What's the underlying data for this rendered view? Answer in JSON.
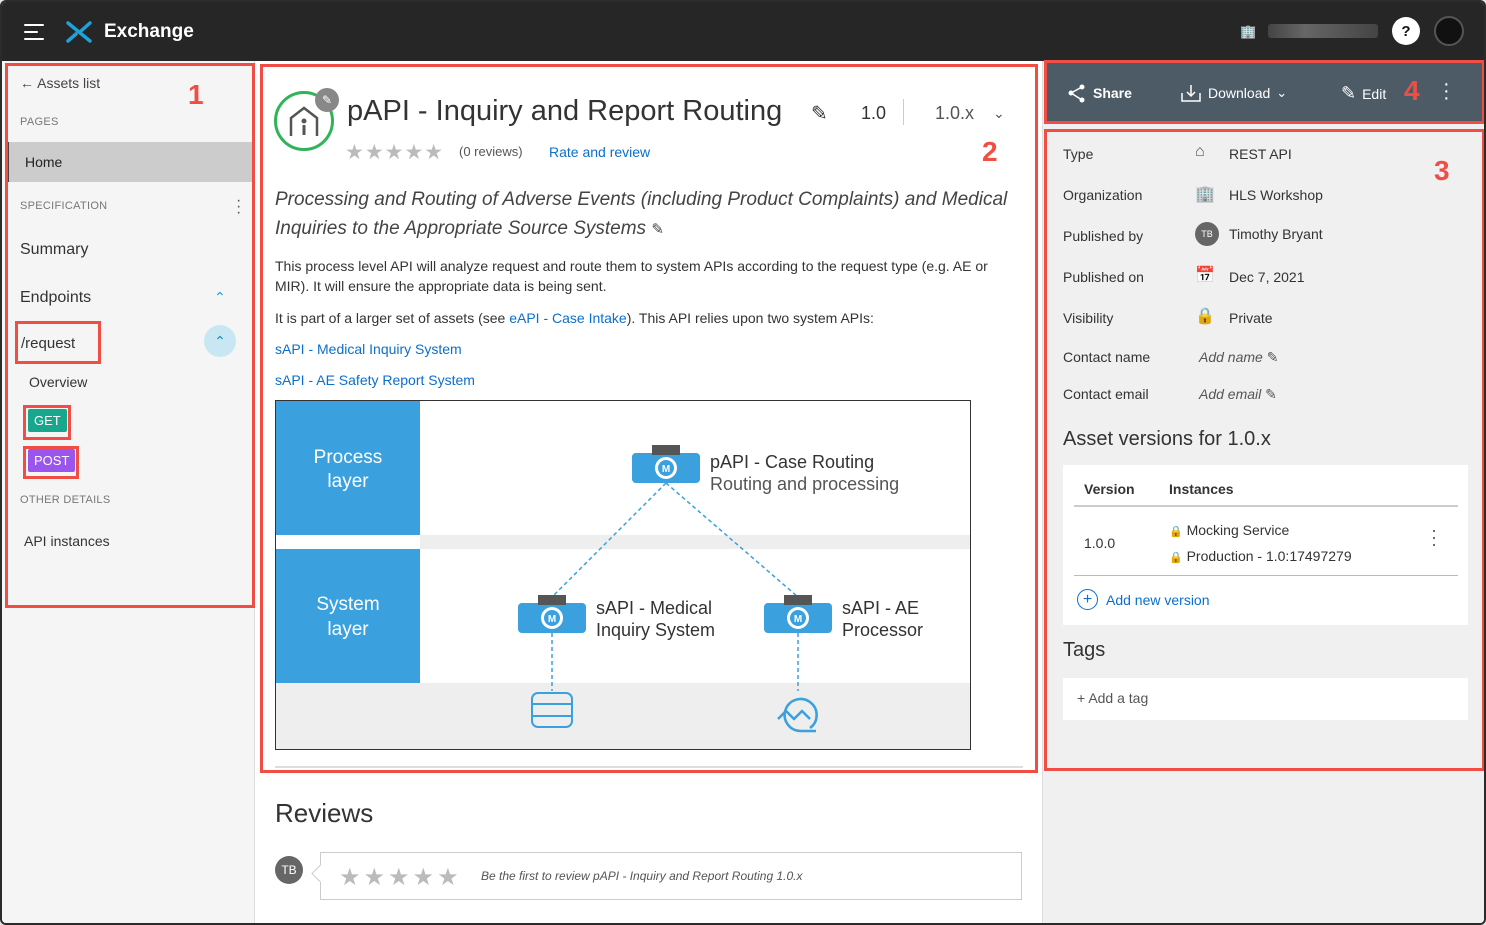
{
  "topbar": {
    "app_title": "Exchange",
    "help": "?"
  },
  "annotations": [
    "1",
    "2",
    "3",
    "4"
  ],
  "sidebar": {
    "back": "Assets list",
    "pages_label": "PAGES",
    "home": "Home",
    "spec_label": "SPECIFICATION",
    "summary": "Summary",
    "endpoints": "Endpoints",
    "request": "/request",
    "overview": "Overview",
    "get": "GET",
    "post": "POST",
    "other_label": "OTHER DETAILS",
    "api_instances": "API instances"
  },
  "asset": {
    "title": "pAPI - Inquiry and Report Routing",
    "version": "1.0",
    "version_select": "1.0.x",
    "stars": "★★★★★",
    "reviews_count": "(0 reviews)",
    "rate_link": "Rate and review",
    "description": "Processing and Routing of Adverse Events (including Product Complaints) and Medical Inquiries to the Appropriate Source Systems",
    "para1": "This process level API will analyze request and route them to system APIs according to the request type (e.g. AE or MIR).  It will ensure the appropriate data is being sent.",
    "para2_prefix": "It is part of a larger set of assets (see ",
    "para2_link": "eAPI - Case Intake",
    "para2_suffix": ").  This API relies upon two system APIs:",
    "link_sapi1": "sAPI - Medical Inquiry System",
    "link_sapi2": "sAPI - AE Safety Report System"
  },
  "diagram": {
    "process_layer": [
      "Process",
      "layer"
    ],
    "system_layer": [
      "System",
      "layer"
    ],
    "papi_title": "pAPI - Case Routing",
    "papi_sub": "Routing and processing",
    "sapi1": [
      "sAPI - Medical",
      "Inquiry System"
    ],
    "sapi2": [
      "sAPI - AE",
      "Processor"
    ]
  },
  "reviews": {
    "heading": "Reviews",
    "avatar": "TB",
    "stars": "★★★★★",
    "placeholder": "Be the first to review pAPI - Inquiry and Report Routing 1.0.x"
  },
  "actions": {
    "share": "Share",
    "download": "Download",
    "edit": "Edit"
  },
  "metadata": {
    "type_label": "Type",
    "type_value": "REST API",
    "org_label": "Organization",
    "org_value": "HLS Workshop",
    "pubby_label": "Published by",
    "pubby_value": "Timothy Bryant",
    "pubby_avatar": "TB",
    "pubon_label": "Published on",
    "pubon_value": "Dec 7, 2021",
    "vis_label": "Visibility",
    "vis_value": "Private",
    "cname_label": "Contact name",
    "cname_value": "Add name",
    "cemail_label": "Contact email",
    "cemail_value": "Add email"
  },
  "versions": {
    "heading": "Asset versions for 1.0.x",
    "col_version": "Version",
    "col_instances": "Instances",
    "row_version": "1.0.0",
    "instance1": "Mocking Service",
    "instance2": "Production - 1.0:17497279",
    "add_new": "Add new version"
  },
  "tags": {
    "heading": "Tags",
    "add": "Add a tag"
  },
  "colors": {
    "topbar": "#262626",
    "accent_link": "#0b6fcc",
    "get_badge": "#18a78c",
    "post_badge": "#9a55ec",
    "annotation_red": "#f04e45",
    "action_bar": "#4d5b67",
    "diagram_blue": "#3aa0de"
  }
}
